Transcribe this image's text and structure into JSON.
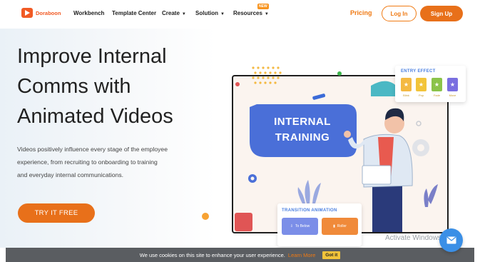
{
  "nav": {
    "logo_text": "Doraboon",
    "items": [
      "Workbench",
      "Template Center",
      "Create",
      "Solution",
      "Resources"
    ],
    "new_badge": "NEW",
    "pricing": "Pricing",
    "login": "Log In",
    "signup": "Sign Up"
  },
  "hero": {
    "headline_lines": [
      "Improve Internal",
      "Comms with",
      "Animated Videos"
    ],
    "description_lines": [
      "Videos positively influence every stage of the employee",
      "experience, from recruiting to onboarding to training",
      "and everyday internal communications."
    ],
    "cta": "TRY IT FREE"
  },
  "illustration": {
    "training_lines": [
      "INTERNAL",
      "TRAINING"
    ],
    "entry_effect": {
      "title": "ENTRY EFFECT",
      "tiles": [
        {
          "label": "Blink",
          "color": "#f4b942"
        },
        {
          "label": "Pop",
          "color": "#f2c43a"
        },
        {
          "label": "Fade",
          "color": "#8bc34a"
        },
        {
          "label": "Move",
          "color": "#7a6fe0"
        }
      ]
    },
    "transition": {
      "title": "TRANSITION ANIMATION",
      "buttons": [
        {
          "label": "To Below",
          "color": "#7b8ee8"
        },
        {
          "label": "Roller",
          "color": "#f08a3a"
        }
      ]
    }
  },
  "system": {
    "activate_windows": "Activate Windows"
  },
  "cookie": {
    "text": "We use cookies on this site to enhance your user experience.",
    "learn_more": "Learn More",
    "got_it": "Got it"
  },
  "colors": {
    "brand": "#e8701a",
    "accent_blue": "#4a6fd8",
    "cookie_bg": "#5a5d61"
  }
}
